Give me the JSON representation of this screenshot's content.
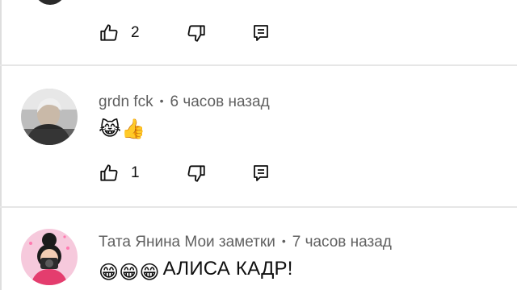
{
  "comments": [
    {
      "likes": "2"
    },
    {
      "author": "grdn fck",
      "separator": "•",
      "time": "6 часов назад",
      "text": "😹👍",
      "likes": "1"
    },
    {
      "author": "Тата Янина Мои заметки",
      "separator": "•",
      "time": "7 часов назад",
      "text_emoji": "😁😁😁",
      "text": "АЛИСА КАДР!"
    }
  ],
  "icons": {
    "like": "thumbs-up-icon",
    "dislike": "thumbs-down-icon",
    "reply": "reply-comment-icon"
  },
  "colors": {
    "meta_text": "#606060",
    "primary_text": "#0f0f0f",
    "divider": "#e6e6e6"
  }
}
